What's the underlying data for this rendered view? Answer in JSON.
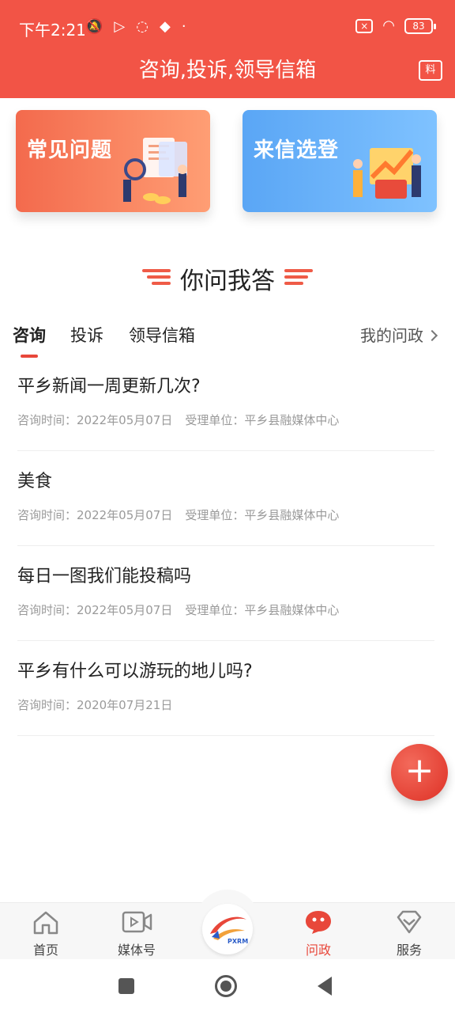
{
  "status_bar": {
    "time": "下午2:21",
    "battery": "83"
  },
  "header": {
    "title": "咨询,投诉,领导信箱",
    "action_label": "料"
  },
  "cards": {
    "faq": "常见问题",
    "letters": "来信选登"
  },
  "section": {
    "title": "你问我答"
  },
  "tabs": {
    "items": [
      "咨询",
      "投诉",
      "领导信箱"
    ],
    "active_index": 0,
    "my_link": "我的问政"
  },
  "list": [
    {
      "title": "平乡新闻一周更新几次?",
      "time_label": "咨询时间：2022年05月07日",
      "unit_label": "受理单位：平乡县融媒体中心"
    },
    {
      "title": "美食",
      "time_label": "咨询时间：2022年05月07日",
      "unit_label": "受理单位：平乡县融媒体中心"
    },
    {
      "title": "每日一图我们能投稿吗",
      "time_label": "咨询时间：2022年05月07日",
      "unit_label": "受理单位：平乡县融媒体中心"
    },
    {
      "title": "平乡有什么可以游玩的地儿吗?",
      "time_label": "咨询时间：2020年07月21日",
      "unit_label": ""
    }
  ],
  "fab": {
    "label": "+"
  },
  "bottom_nav": {
    "items": [
      {
        "label": "首页",
        "icon": "home-icon"
      },
      {
        "label": "媒体号",
        "icon": "video-icon"
      },
      {
        "label": "问政",
        "icon": "chat-bubble-icon"
      },
      {
        "label": "服务",
        "icon": "diamond-icon"
      }
    ],
    "logo_text": "PXRM",
    "active_index": 2
  },
  "colors": {
    "primary": "#f25446",
    "accent_red": "#e8473a",
    "faq_gradient": [
      "#f36a4d",
      "#ff9e74"
    ],
    "letters_gradient": [
      "#5aa6f5",
      "#7fc2ff"
    ]
  }
}
